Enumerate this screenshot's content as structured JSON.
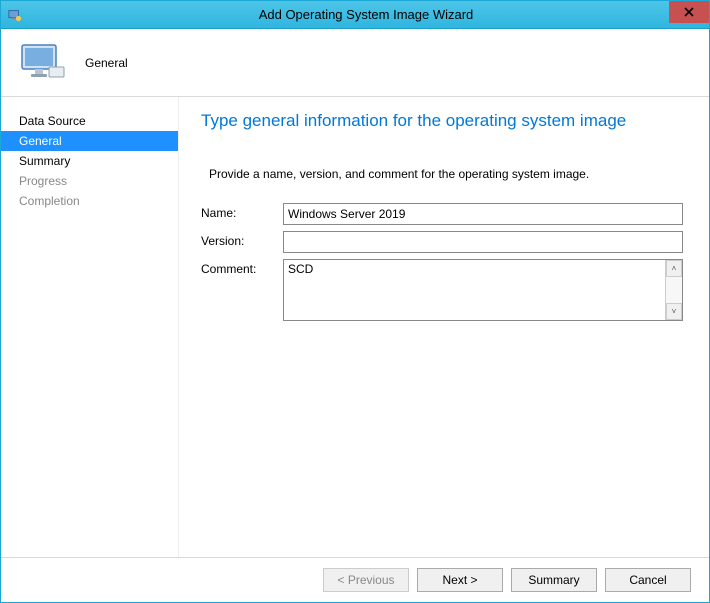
{
  "window": {
    "title": "Add Operating System Image Wizard"
  },
  "header": {
    "label": "General"
  },
  "sidebar": {
    "items": [
      {
        "label": "Data Source",
        "state": "normal"
      },
      {
        "label": "General",
        "state": "active"
      },
      {
        "label": "Summary",
        "state": "normal"
      },
      {
        "label": "Progress",
        "state": "disabled"
      },
      {
        "label": "Completion",
        "state": "disabled"
      }
    ]
  },
  "page": {
    "title": "Type general information for the operating system image",
    "instruction": "Provide a name, version, and comment for the operating system image."
  },
  "form": {
    "name_label": "Name:",
    "name_value": "Windows Server 2019",
    "version_label": "Version:",
    "version_value": "",
    "comment_label": "Comment:",
    "comment_value": "SCD"
  },
  "buttons": {
    "previous": "< Previous",
    "next": "Next >",
    "summary": "Summary",
    "cancel": "Cancel"
  }
}
